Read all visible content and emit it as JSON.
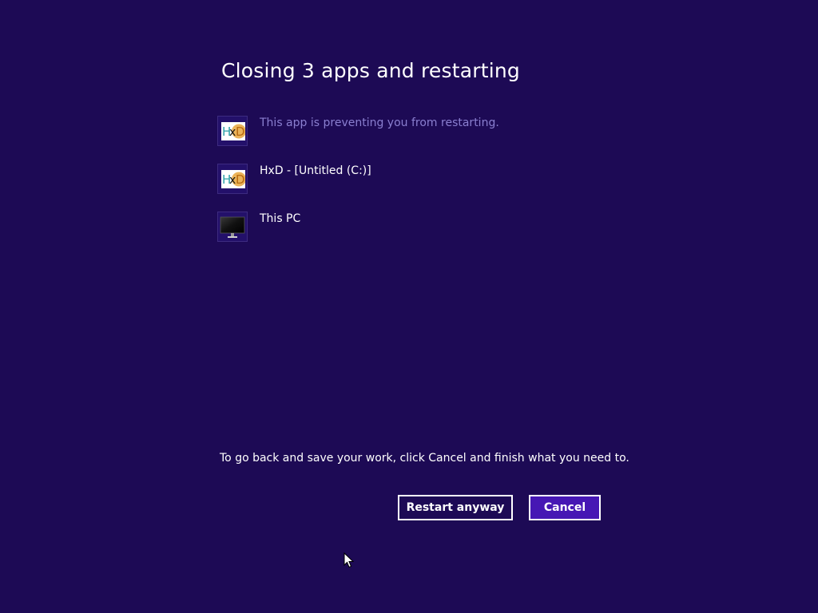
{
  "page": {
    "title": "Closing 3 apps and restarting",
    "background_color": "#1d0a55"
  },
  "apps": [
    {
      "icon": "hxd-app-icon",
      "label": "This app is preventing you from restarting.",
      "muted": true
    },
    {
      "icon": "hxd-app-icon",
      "label": "HxD - [Untitled (C:)]",
      "muted": false
    },
    {
      "icon": "computer-monitor-icon",
      "label": "This PC",
      "muted": false
    }
  ],
  "hint": "To go back and save your work, click Cancel and finish what you need to.",
  "buttons": {
    "restart_label": "Restart anyway",
    "cancel_label": "Cancel",
    "cancel_color": "#4617b4"
  },
  "hxd_logo_text": {
    "h": "H",
    "x": "x",
    "d": "D"
  }
}
